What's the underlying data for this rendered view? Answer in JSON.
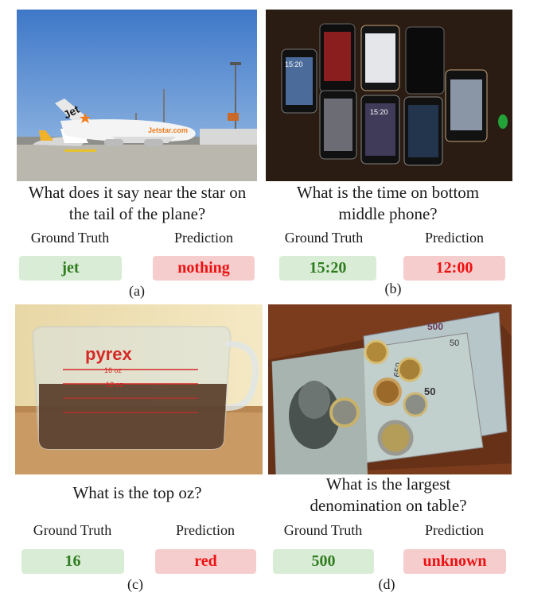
{
  "panels": [
    {
      "question": "What does it say near the star on the tail of the plane?",
      "gt_label": "Ground Truth",
      "pred_label": "Prediction",
      "ground_truth": "jet",
      "prediction": "nothing",
      "sublabel": "(a)",
      "photo_text": [
        "Jet",
        "Jetstar.com"
      ]
    },
    {
      "question": "What is the time on bottom middle phone?",
      "gt_label": "Ground Truth",
      "pred_label": "Prediction",
      "ground_truth": "15:20",
      "prediction": "12:00",
      "sublabel": "(b)",
      "photo_text": [
        "15:20",
        "15:20"
      ]
    },
    {
      "question": "What is the top oz?",
      "gt_label": "Ground Truth",
      "pred_label": "Prediction",
      "ground_truth": "16",
      "prediction": "red",
      "sublabel": "(c)",
      "photo_text": [
        "pyrex",
        "16 oz",
        "12 oz"
      ]
    },
    {
      "question": "What is the largest denomination on table?",
      "gt_label": "Ground Truth",
      "pred_label": "Prediction",
      "ground_truth": "500",
      "prediction": "unknown",
      "sublabel": "(d)",
      "photo_text": [
        "500",
        "50",
        "650",
        "50"
      ]
    }
  ]
}
